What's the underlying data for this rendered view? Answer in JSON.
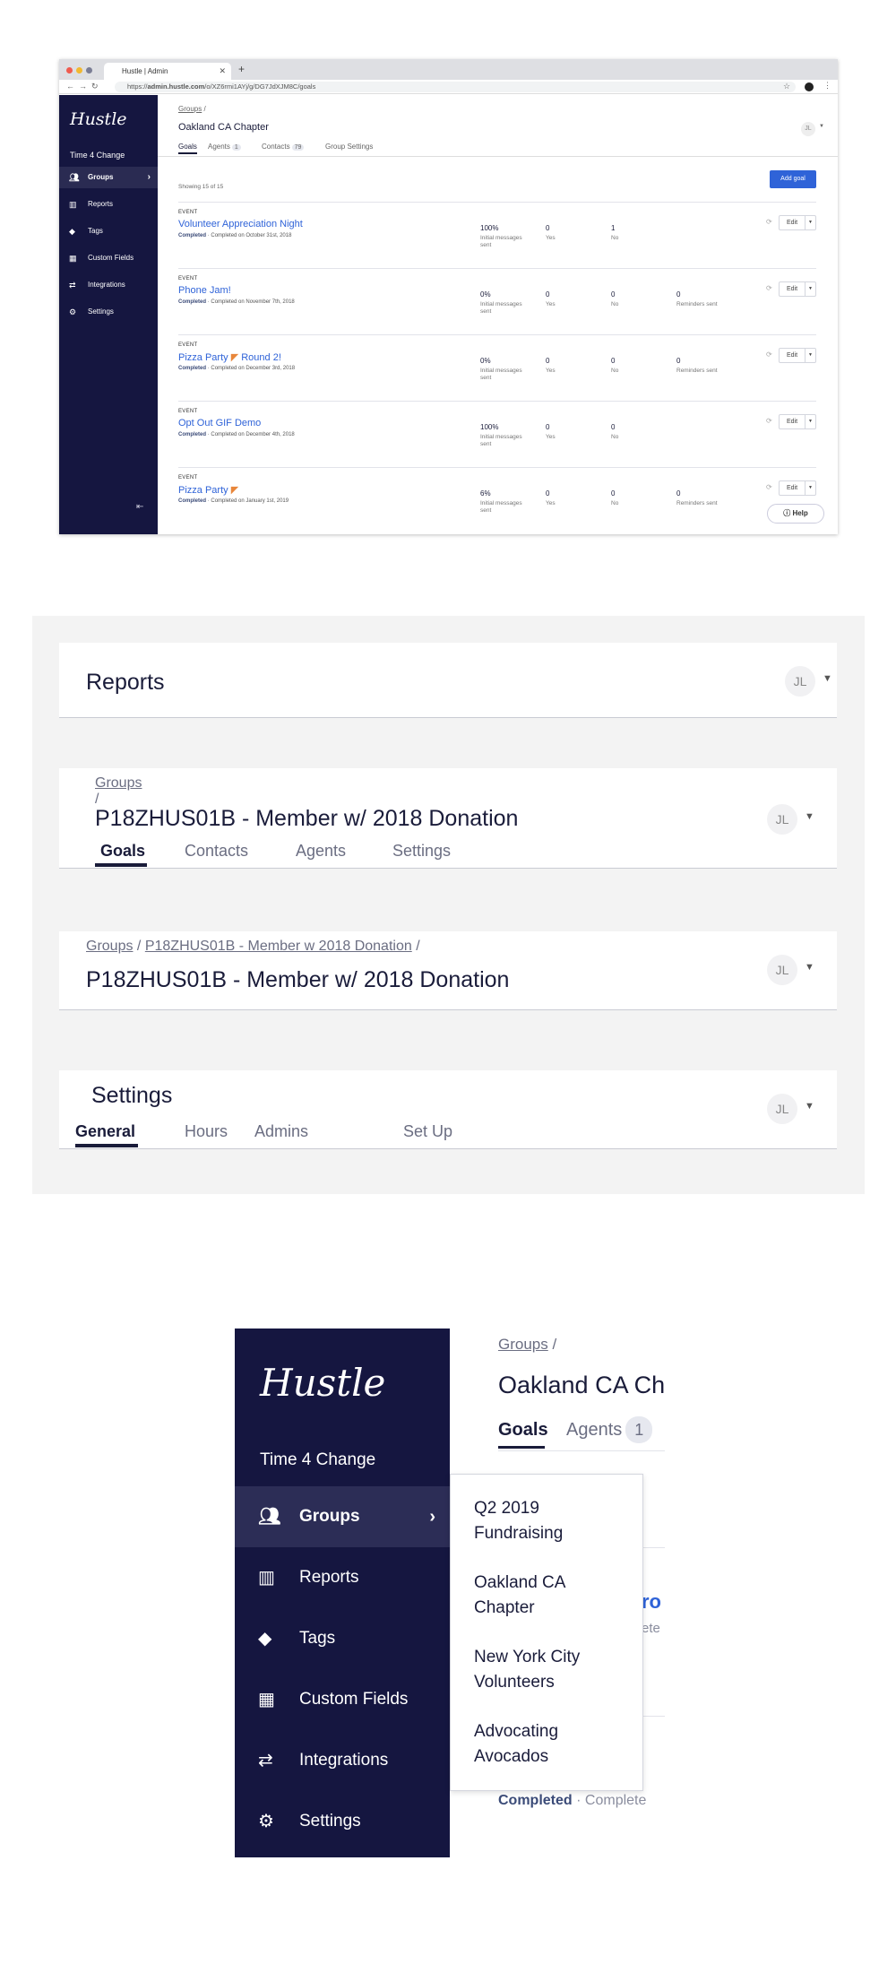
{
  "browser": {
    "tab_title": "Hustle | Admin",
    "url_host": "admin.hustle.com",
    "url_path": "/o/XZ6rmi1AYj/g/DG7JdXJM8C/goals",
    "url_scheme": "https://",
    "sidebar": {
      "logo": "Hustle",
      "org": "Time 4 Change",
      "items": [
        {
          "label": "Groups",
          "icon": "groups-icon"
        },
        {
          "label": "Reports",
          "icon": "bar-chart-icon"
        },
        {
          "label": "Tags",
          "icon": "tag-icon"
        },
        {
          "label": "Custom Fields",
          "icon": "custom-fields-icon"
        },
        {
          "label": "Integrations",
          "icon": "swap-arrows-icon"
        },
        {
          "label": "Settings",
          "icon": "gear-icon"
        }
      ]
    },
    "breadcrumb": "Groups",
    "title": "Oakland CA Chapter",
    "avatar": "JL",
    "tabs": [
      {
        "label": "Goals"
      },
      {
        "label": "Agents",
        "count": "1"
      },
      {
        "label": "Contacts",
        "count": "79"
      },
      {
        "label": "Group Settings"
      }
    ],
    "showing": "Showing 15 of 15",
    "add_goal": "Add goal",
    "edit_label": "Edit",
    "help_label": "Help",
    "goals": [
      {
        "type": "EVENT",
        "name": "Volunteer Appreciation Night",
        "status": "Completed",
        "completed_on": "Completed on October 31st, 2018",
        "sent": "100%",
        "yes": "0",
        "no": "1",
        "reminders": ""
      },
      {
        "type": "EVENT",
        "name": "Phone Jam!",
        "status": "Completed",
        "completed_on": "Completed on November 7th, 2018",
        "sent": "0%",
        "yes": "0",
        "no": "0",
        "reminders": "0"
      },
      {
        "type": "EVENT",
        "name_a": "Pizza Party",
        "name_b": "Round 2!",
        "status": "Completed",
        "completed_on": "Completed on December 3rd, 2018",
        "sent": "0%",
        "yes": "0",
        "no": "0",
        "reminders": "0"
      },
      {
        "type": "EVENT",
        "name": "Opt Out GIF Demo",
        "status": "Completed",
        "completed_on": "Completed on December 4th, 2018",
        "sent": "100%",
        "yes": "0",
        "no": "0",
        "reminders": ""
      },
      {
        "type": "EVENT",
        "name": "Pizza Party",
        "status": "Completed",
        "completed_on": "Completed on January 1st, 2019",
        "sent": "6%",
        "yes": "0",
        "no": "0",
        "reminders": "0"
      }
    ],
    "labels": {
      "sent_1": "Initial messages",
      "sent_2": "sent",
      "yes": "Yes",
      "no": "No",
      "reminders": "Reminders sent",
      "separator": "·"
    }
  },
  "panel": {
    "reports": {
      "title": "Reports",
      "avatar": "JL"
    },
    "group_detail": {
      "crumb": "Groups",
      "crumb_sep": "/",
      "title": "P18ZHUS01B - Member w/ 2018 Donation",
      "avatar": "JL",
      "tabs": [
        "Goals",
        "Contacts",
        "Agents",
        "Settings"
      ]
    },
    "group_crumb": {
      "crumb_1": "Groups",
      "crumb_2": "P18ZHUS01B - Member w 2018 Donation",
      "sep": "/",
      "title": "P18ZHUS01B - Member w/ 2018 Donation",
      "avatar": "JL"
    },
    "settings": {
      "title": "Settings",
      "avatar": "JL",
      "tabs": [
        "General",
        "Hours",
        "Admins",
        "Set Up"
      ]
    }
  },
  "zoom": {
    "logo": "Hustle",
    "org": "Time 4 Change",
    "items": [
      "Groups",
      "Reports",
      "Tags",
      "Custom Fields",
      "Integrations",
      "Settings"
    ],
    "crumb": "Groups",
    "crumb_sep": "/",
    "title": "Oakland CA Ch",
    "tabs": [
      {
        "label": "Goals"
      },
      {
        "label": "Agents",
        "count": "1"
      }
    ],
    "bg_link": "ro",
    "bg_small": "ete",
    "completed": "Completed",
    "separator": "·",
    "completed_more": "Complete",
    "dropdown": [
      "Q2 2019 Fundraising",
      "Oakland CA Chapter",
      "New York City Volunteers",
      "Advocating Avocados"
    ]
  },
  "colors": {
    "sidebar": "#151640",
    "accent": "#2f63d8",
    "text": "#1a1c3a",
    "panel_bg": "#f3f3f3"
  }
}
